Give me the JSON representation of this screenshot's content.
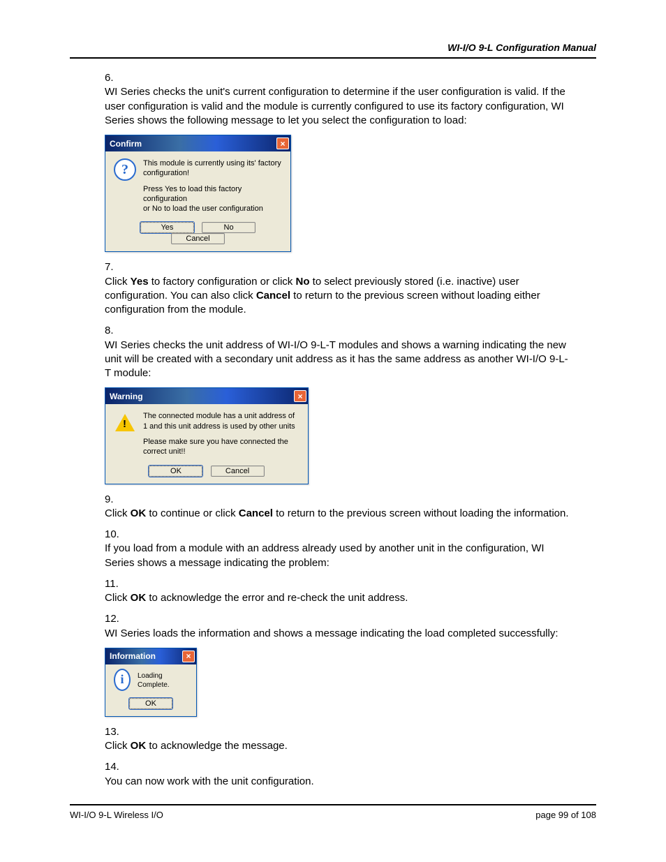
{
  "header": {
    "title": "WI-I/O 9-L Configuration Manual"
  },
  "steps": {
    "s6": {
      "num": "6.",
      "text": "WI Series checks the unit's current configuration to determine if the user configuration is valid. If the user configuration is valid and the module is currently configured to use its factory configuration, WI Series shows the following message to let you select the configuration to load:"
    },
    "s7": {
      "num": "7.",
      "pre": "Click ",
      "b1": "Yes",
      "mid1": " to factory configuration or click ",
      "b2": "No",
      "mid2": " to select previously stored (i.e. inactive) user configuration. You can also click ",
      "b3": "Cancel",
      "post": " to return to the previous screen without loading either configuration from the module."
    },
    "s8": {
      "num": "8.",
      "text": " WI Series checks the unit address of WI-I/O 9-L-T modules and shows a warning indicating the new unit will be created with a secondary unit address as it has the same address as another WI-I/O 9-L-T module:"
    },
    "s9": {
      "num": "9.",
      "pre": "Click ",
      "b1": "OK",
      "mid1": " to continue or click ",
      "b2": "Cancel",
      "post": " to return to the previous screen without loading the information."
    },
    "s10": {
      "num": "10.",
      "text": "If you load from a module with an address already used by another unit in the configuration, WI Series shows a message indicating the problem:"
    },
    "s11": {
      "num": "11.",
      "pre": "Click ",
      "b1": "OK",
      "post": " to acknowledge the error and re-check the unit address."
    },
    "s12": {
      "num": "12.",
      "text": "WI Series loads the information and shows a message indicating the load completed successfully:"
    },
    "s13": {
      "num": "13.",
      "pre": "Click ",
      "b1": "OK",
      "post": " to acknowledge the message."
    },
    "s14": {
      "num": "14.",
      "text": "You can now work with the unit configuration."
    }
  },
  "dialog1": {
    "title": "Confirm",
    "line1": "This module is currently using its' factory configuration!",
    "line2": "Press Yes to load this factory configuration",
    "line3": "or   No  to load the user configuration",
    "btnYes": "Yes",
    "btnNo": "No",
    "btnCancel": "Cancel"
  },
  "dialog2": {
    "title": "Warning",
    "line1": "The connected module has a unit address of 1 and this unit address is used by other units",
    "line2": "Please make sure you have connected the correct unit!!",
    "btnOk": "OK",
    "btnCancel": "Cancel"
  },
  "dialog3": {
    "title": "Information",
    "line1": "Loading Complete.",
    "btnOk": "OK"
  },
  "footer": {
    "left": "WI-I/O 9-L Wireless I/O",
    "right": "page  99 of 108"
  }
}
